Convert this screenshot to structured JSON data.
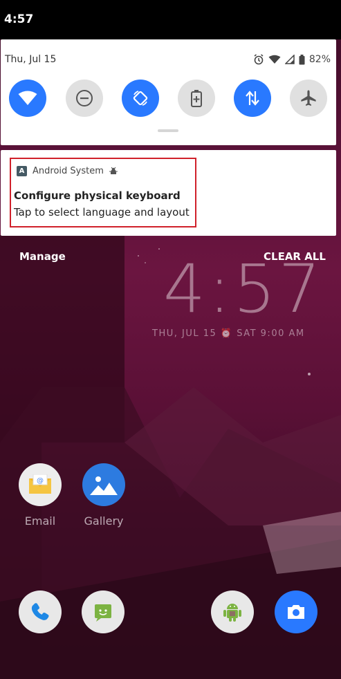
{
  "status_bar": {
    "time": "4:57"
  },
  "quick_settings": {
    "date": "Thu, Jul 15",
    "battery": "82%",
    "tiles": [
      {
        "name": "wifi",
        "state": "on"
      },
      {
        "name": "do-not-disturb",
        "state": "off"
      },
      {
        "name": "auto-rotate",
        "state": "on"
      },
      {
        "name": "battery-saver",
        "state": "off"
      },
      {
        "name": "mobile-data",
        "state": "on"
      },
      {
        "name": "airplane-mode",
        "state": "off"
      }
    ]
  },
  "notification": {
    "app_name": "Android System",
    "app_icon_letter": "A",
    "title": "Configure physical keyboard",
    "text": "Tap to select language and layout"
  },
  "actions": {
    "manage": "Manage",
    "clear_all": "CLEAR ALL"
  },
  "lockscreen": {
    "clock": "4:57",
    "date_line": "THU, JUL 15 ⏰ SAT 9:00 AM"
  },
  "apps": [
    {
      "label": "Email"
    },
    {
      "label": "Gallery"
    }
  ],
  "colors": {
    "accent": "#2979ff",
    "tile_off": "#e0e0e0",
    "highlight": "#d0202a"
  }
}
